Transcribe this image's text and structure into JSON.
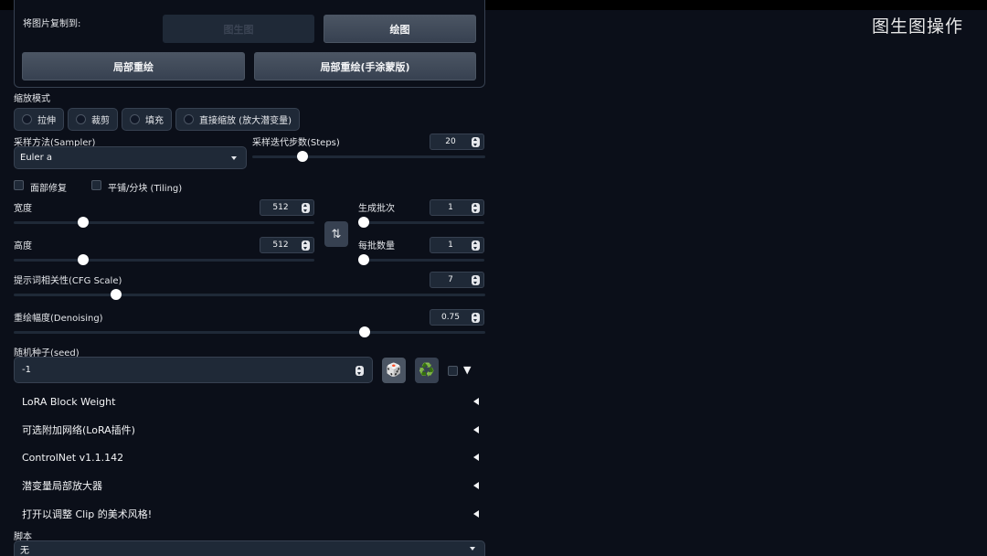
{
  "watermark": "图生图操作",
  "copy_section": {
    "label": "将图片复制到:",
    "img2img_button": "图生图",
    "sketch_button": "绘图",
    "inpaint_button": "局部重绘",
    "inpaint_sketch_button": "局部重绘(手涂蒙版)"
  },
  "resize_mode": {
    "label": "缩放模式",
    "options": [
      "拉伸",
      "裁剪",
      "填充",
      "直接缩放 (放大潜变量)"
    ]
  },
  "sampler": {
    "label": "采样方法(Sampler)",
    "value": "Euler a"
  },
  "steps": {
    "label": "采样迭代步数(Steps)",
    "value": "20",
    "level": 0.2
  },
  "checkboxes": {
    "face_restore": "面部修复",
    "tiling": "平铺/分块 (Tiling)"
  },
  "width": {
    "label": "宽度",
    "value": "512",
    "level": 0.22
  },
  "height": {
    "label": "高度",
    "value": "512",
    "level": 0.22
  },
  "batch_count": {
    "label": "生成批次",
    "value": "1",
    "level": 0.0
  },
  "batch_size": {
    "label": "每批数量",
    "value": "1",
    "level": 0.0
  },
  "swap_icon": "⇅",
  "cfg": {
    "label": "提示词相关性(CFG Scale)",
    "value": "7",
    "level": 0.21
  },
  "denoise": {
    "label": "重绘幅度(Denoising)",
    "value": "0.75",
    "level": 0.75
  },
  "seed": {
    "label": "随机种子(seed)",
    "value": "-1",
    "dice_icon": "🎲",
    "recycle_icon": "♻️",
    "extra_arrow": "▼"
  },
  "accordions": [
    "LoRA Block Weight",
    "可选附加网络(LoRA插件)",
    "ControlNet v1.1.142",
    "潜变量局部放大器",
    "打开以调整 Clip 的美术风格!"
  ],
  "script": {
    "label": "脚本",
    "value": "无"
  },
  "colors": {
    "background": "#0b0f19",
    "panel": "#1f2937",
    "border": "#374151",
    "recycle_green": "#10b981"
  }
}
